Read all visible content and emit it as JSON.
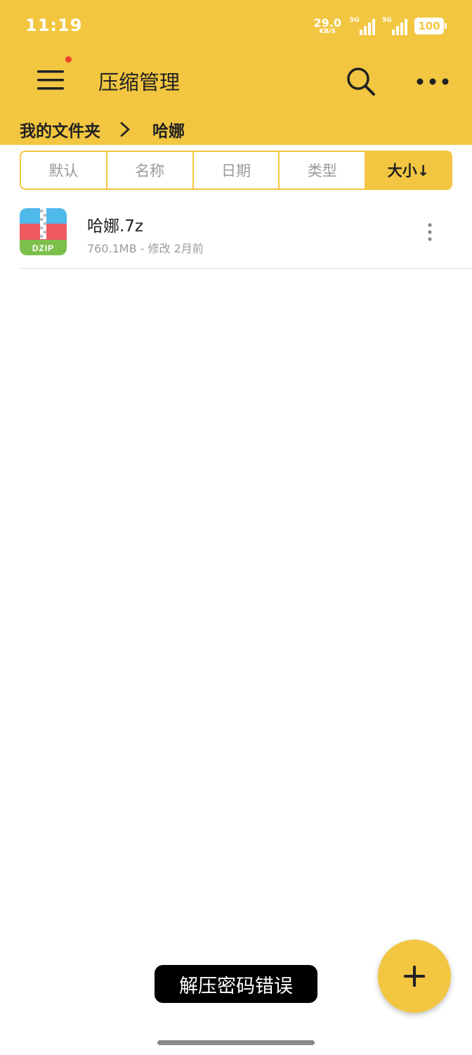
{
  "status_bar": {
    "time": "11:19",
    "net_speed": "29.0",
    "net_speed_unit": "KB/S",
    "signal_1_label": "5G",
    "signal_2_label": "5G",
    "battery": "100"
  },
  "toolbar": {
    "title": "压缩管理",
    "menu_icon": "hamburger-menu-icon",
    "search_icon": "search-icon",
    "more_icon": "more-horizontal-icon",
    "accent_color": "#f2c641"
  },
  "breadcrumb": {
    "items": [
      "我的文件夹",
      "哈娜"
    ],
    "separator_icon": "chevron-right-icon"
  },
  "sort_tabs": [
    {
      "label": "默认"
    },
    {
      "label": "名称"
    },
    {
      "label": "日期"
    },
    {
      "label": "类型"
    },
    {
      "label": "大小↓",
      "active": true
    }
  ],
  "files": [
    {
      "name": "哈娜.7z",
      "meta": "760.1MB - 修改 2月前",
      "icon_label": "DZIP",
      "icon": "zip-archive-icon"
    }
  ],
  "toast": {
    "message": "解压密码错误"
  },
  "fab": {
    "icon": "plus-icon"
  }
}
